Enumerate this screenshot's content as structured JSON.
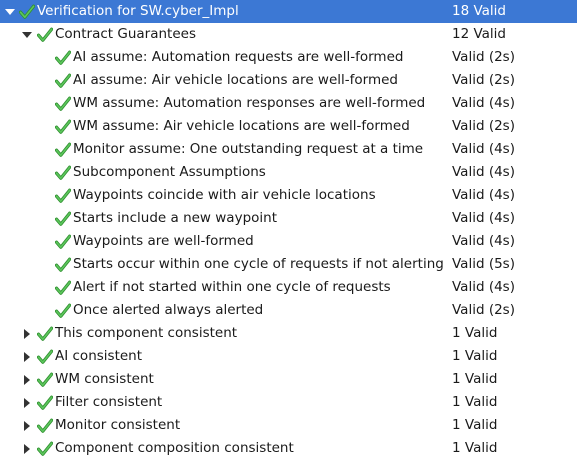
{
  "root": {
    "label": "Verification for SW.cyber_Impl",
    "status": "18 Valid",
    "icon": "check-icon",
    "expanded": true
  },
  "contract": {
    "label": "Contract Guarantees",
    "status": "12 Valid",
    "icon": "check-icon",
    "expanded": true,
    "items": [
      {
        "label": "AI assume: Automation requests are well-formed",
        "status": "Valid (2s)"
      },
      {
        "label": "AI assume: Air vehicle locations are well-formed",
        "status": "Valid (2s)"
      },
      {
        "label": "WM assume: Automation responses are well-formed",
        "status": "Valid (4s)"
      },
      {
        "label": "WM assume: Air vehicle locations are well-formed",
        "status": "Valid (2s)"
      },
      {
        "label": "Monitor assume: One outstanding request at a time",
        "status": "Valid (4s)"
      },
      {
        "label": "Subcomponent Assumptions",
        "status": "Valid (4s)"
      },
      {
        "label": "Waypoints coincide with air vehicle locations",
        "status": "Valid (4s)"
      },
      {
        "label": "Starts include a new waypoint",
        "status": "Valid (4s)"
      },
      {
        "label": "Waypoints are well-formed",
        "status": "Valid (4s)"
      },
      {
        "label": "Starts occur within one cycle of requests if not alerting",
        "status": "Valid (5s)"
      },
      {
        "label": "Alert if not started within one cycle of requests",
        "status": "Valid (4s)"
      },
      {
        "label": "Once alerted always alerted",
        "status": "Valid (2s)"
      }
    ]
  },
  "groups": [
    {
      "label": "This component consistent",
      "status": "1 Valid"
    },
    {
      "label": "AI consistent",
      "status": "1 Valid"
    },
    {
      "label": "WM consistent",
      "status": "1 Valid"
    },
    {
      "label": "Filter consistent",
      "status": "1 Valid"
    },
    {
      "label": "Monitor consistent",
      "status": "1 Valid"
    },
    {
      "label": "Component composition consistent",
      "status": "1 Valid"
    }
  ],
  "colors": {
    "selection": "#3c78d4",
    "check": "#3aa53a"
  }
}
